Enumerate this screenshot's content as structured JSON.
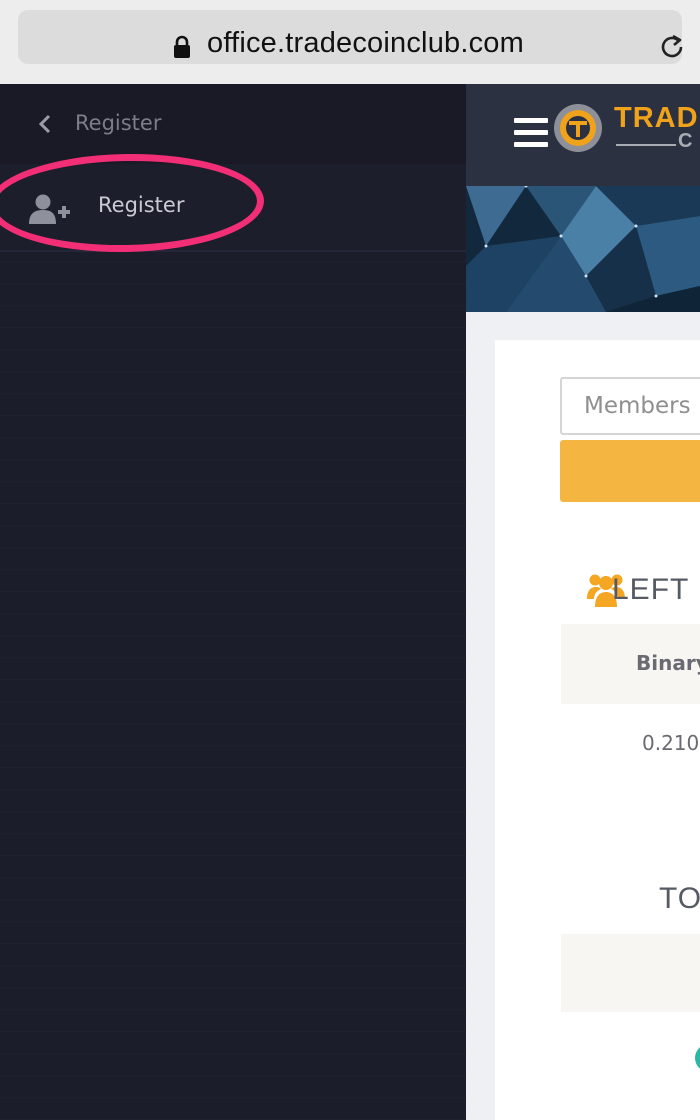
{
  "browser": {
    "url": "office.tradecoinclub.com",
    "icons": [
      "lock-icon",
      "reload-icon"
    ]
  },
  "sidebar": {
    "header_title": "Register",
    "items": [
      {
        "label": "Register",
        "icon": "add-user-icon"
      }
    ],
    "highlight_color": "#f22f76"
  },
  "main": {
    "logo_text": "TRADE",
    "logo_sub": "C",
    "members_input_placeholder": "Members L",
    "left_heading": "LEFT",
    "table_header": "Binary",
    "table_value": "0.210",
    "total_heading": "TOT",
    "accent_color": "#f5b641"
  }
}
